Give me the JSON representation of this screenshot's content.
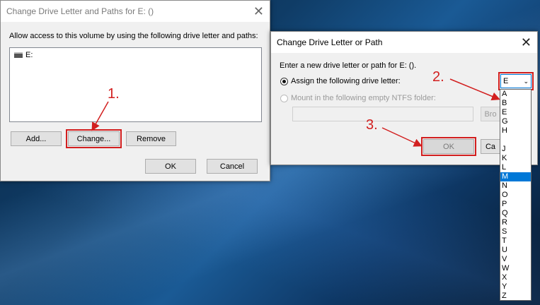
{
  "dialog1": {
    "title": "Change Drive Letter and Paths for E: ()",
    "close_glyph": "✕",
    "description": "Allow access to this volume by using the following drive letter and paths:",
    "list_items": [
      "E:"
    ],
    "add_label": "Add...",
    "change_label": "Change...",
    "remove_label": "Remove",
    "ok_label": "OK",
    "cancel_label": "Cancel"
  },
  "dialog2": {
    "title": "Change Drive Letter or Path",
    "close_glyph": "✕",
    "prompt": "Enter a new drive letter or path for E: ().",
    "assign_label": "Assign the following drive letter:",
    "mount_label": "Mount in the following empty NTFS folder:",
    "browse_label": "Bro",
    "ok_label": "OK",
    "cancel_label": "Ca",
    "selected_letter": "E",
    "dropdown_letters": [
      "A",
      "B",
      "E",
      "G",
      "H",
      "",
      "J",
      "K",
      "L",
      "M",
      "N",
      "O",
      "P",
      "Q",
      "R",
      "S",
      "T",
      "U",
      "V",
      "W",
      "X",
      "Y",
      "Z"
    ],
    "highlighted_letter": "M"
  },
  "annotations": {
    "step1": "1.",
    "step2": "2.",
    "step3": "3."
  },
  "colors": {
    "annotation_red": "#d21f1f",
    "selection_blue": "#0078d7"
  }
}
